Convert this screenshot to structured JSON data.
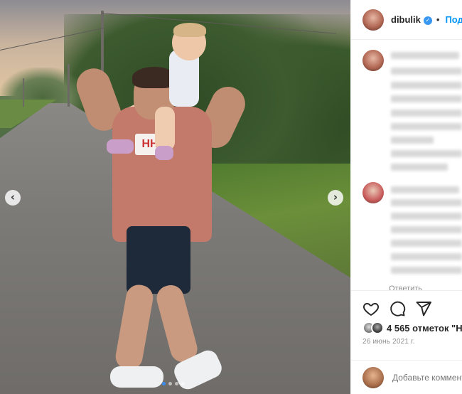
{
  "photo": {
    "alt": "",
    "prev_arrow": "‹",
    "next_arrow": "›",
    "logo_text": "HH",
    "carousel": {
      "total_slides": 4,
      "active_index": 0
    }
  },
  "post_header": {
    "username": "dibulik",
    "verified_icon": "verified-badge-icon",
    "separator": "•",
    "follow_label": "Подп"
  },
  "comments": [
    {
      "avatar_color": "#b96b5a"
    },
    {
      "avatar_color": "#c85a5a"
    }
  ],
  "reply_label": "Ответить",
  "actions": {
    "like_icon": "heart-icon",
    "comment_icon": "comment-icon",
    "share_icon": "send-icon"
  },
  "likes": {
    "text": "4 565 отметок \"Н"
  },
  "date": "26 июнь 2021 г.",
  "add_comment": {
    "placeholder": "Добавьте комментарий..."
  },
  "colors": {
    "follow_blue": "#0095f6",
    "verified_blue": "#3897f0",
    "active_dot": "#3c8cf0",
    "secondary_text": "#8e8e8e"
  }
}
